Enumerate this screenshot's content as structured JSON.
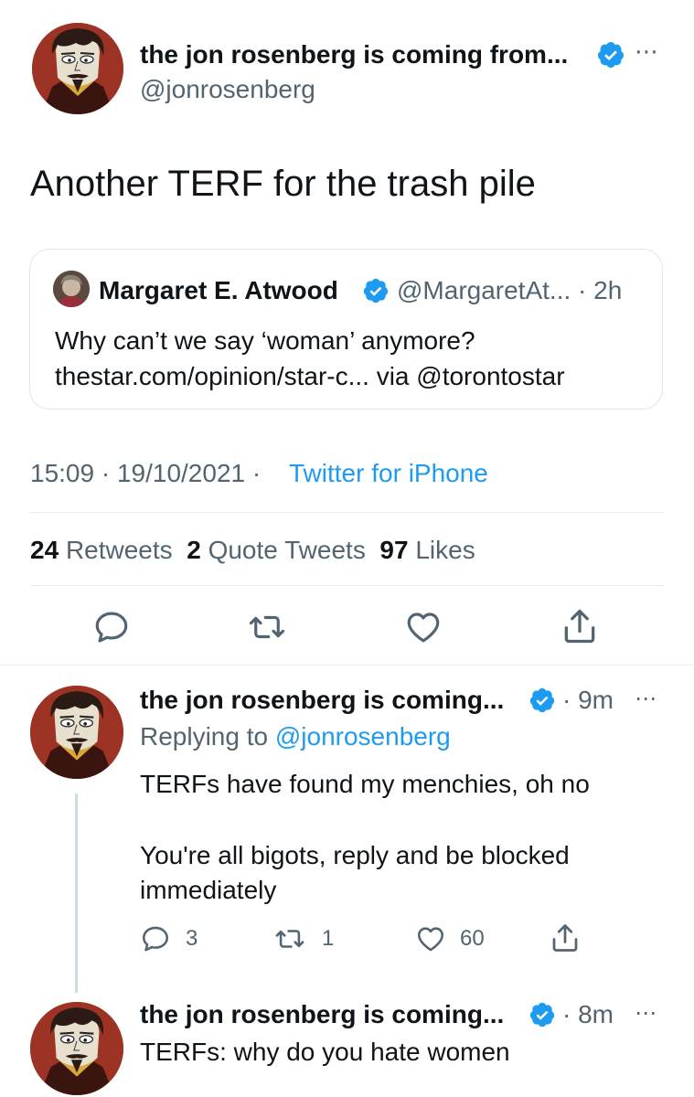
{
  "main_tweet": {
    "display_name": "the jon rosenberg is coming from...",
    "handle": "@jonrosenberg",
    "text": "Another TERF for the trash pile",
    "quoted": {
      "display_name": "Margaret E. Atwood",
      "handle_time": "@MargaretAt... · 2h",
      "line1": "Why can’t we say ‘woman’ anymore?",
      "line2": "thestar.com/opinion/star-c... via @torontostar"
    },
    "timestamp": "15:09 · 19/10/2021 ·",
    "source": "Twitter for iPhone",
    "stats": {
      "retweets_count": "24",
      "retweets_label": "Retweets",
      "quotes_count": "2",
      "quotes_label": "Quote Tweets",
      "likes_count": "97",
      "likes_label": "Likes"
    }
  },
  "replies": [
    {
      "display_name": "the jon rosenberg is coming...",
      "time": "· 9m",
      "replying_prefix": "Replying to",
      "replying_handle": "@jonrosenberg",
      "line1": "TERFs have found my menchies, oh no",
      "line2": "You're all bigots, reply and be blocked",
      "line3": "immediately",
      "reply_count": "3",
      "retweet_count": "1",
      "like_count": "60"
    },
    {
      "display_name": "the jon rosenberg is coming...",
      "time": "· 8m",
      "line1": "TERFs: why do you hate women"
    }
  ],
  "icons": {
    "reply": "reply-icon",
    "retweet": "retweet-icon",
    "like": "heart-icon",
    "share": "share-icon",
    "more": "more-icon",
    "verified": "verified-badge-icon"
  },
  "colors": {
    "link_blue": "#1d9bf0",
    "muted_grey": "#536471",
    "text": "#0f1419",
    "divider": "#e6ecf0"
  }
}
